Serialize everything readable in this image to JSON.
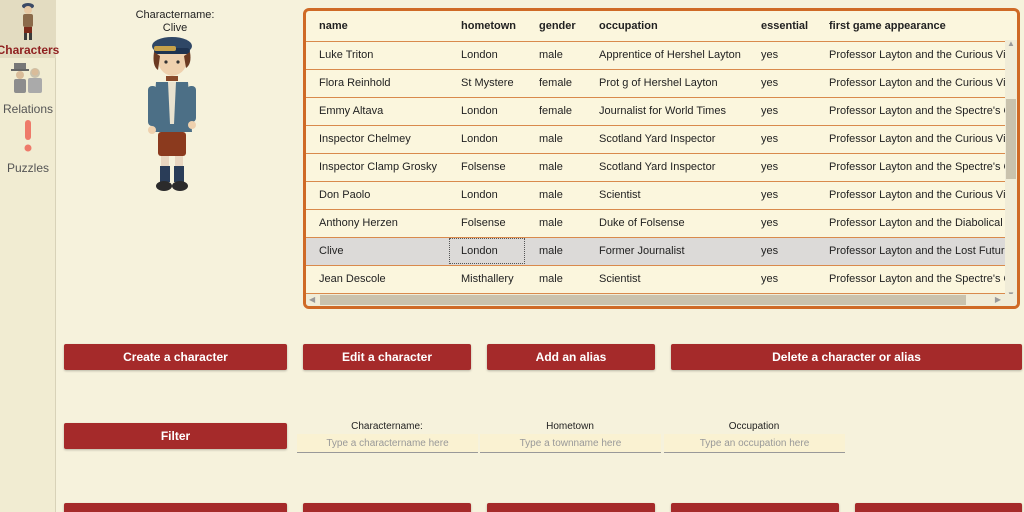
{
  "sidebar": {
    "items": [
      {
        "label": "Characters",
        "icon": "character-icon",
        "active": true
      },
      {
        "label": "Relations",
        "icon": "relations-icon"
      },
      {
        "label": "Puzzles",
        "icon": "puzzle-icon"
      }
    ]
  },
  "preview": {
    "caption_label": "Charactername:",
    "caption_value": "Clive"
  },
  "table": {
    "headers": [
      "name",
      "hometown",
      "gender",
      "occupation",
      "essential",
      "first game appearance"
    ],
    "rows": [
      [
        "Luke Triton",
        "London",
        "male",
        "Apprentice of Hershel Layton",
        "yes",
        "Professor Layton and the Curious Villa"
      ],
      [
        "Flora Reinhold",
        "St Mystere",
        "female",
        "Prot g  of Hershel Layton",
        "yes",
        "Professor Layton and the Curious Villa"
      ],
      [
        "Emmy Altava",
        "London",
        "female",
        "Journalist for World Times",
        "yes",
        "Professor Layton and the Spectre's Ca"
      ],
      [
        "Inspector Chelmey",
        "London",
        "male",
        "Scotland Yard Inspector",
        "yes",
        "Professor Layton and the Curious Villa"
      ],
      [
        "Inspector Clamp Grosky",
        "Folsense",
        "male",
        "Scotland Yard Inspector",
        "yes",
        "Professor Layton and the Spectre's Ca"
      ],
      [
        "Don Paolo",
        "London",
        "male",
        "Scientist",
        "yes",
        "Professor Layton and the Curious Villa"
      ],
      [
        "Anthony Herzen",
        "Folsense",
        "male",
        "Duke of Folsense",
        "yes",
        "Professor Layton and the Diabolical B"
      ],
      [
        "Clive",
        "London",
        "male",
        "Former Journalist",
        "yes",
        "Professor Layton and the Lost Future"
      ],
      [
        "Jean Descole",
        "Misthallery",
        "male",
        "Scientist",
        "yes",
        "Professor Layton and the Spectre's Ca"
      ]
    ],
    "selected_row": 7
  },
  "buttons": {
    "create": "Create a character",
    "edit": "Edit a character",
    "alias": "Add an alias",
    "delete": "Delete a character or alias",
    "filter": "Filter"
  },
  "filter": {
    "name_label": "Charactername:",
    "name_placeholder": "Type a charactername here",
    "town_label": "Hometown",
    "town_placeholder": "Type a townname here",
    "occ_label": "Occupation",
    "occ_placeholder": "Type an occupation here"
  },
  "colors": {
    "accent": "#a52a2a",
    "table_border": "#cf6a26",
    "background": "#f6f2dc"
  }
}
